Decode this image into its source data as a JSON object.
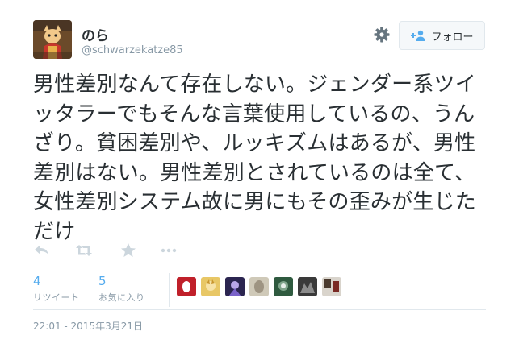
{
  "user": {
    "name": "のら",
    "handle": "@schwarzekatze85"
  },
  "follow_label": "フォロー",
  "tweet_text": "男性差別なんて存在しない。ジェンダー系ツイッタラーでもそんな言葉使用しているの、うんざり。貧困差別や、ルッキズムはあるが、男性差別はない。男性差別とされているのは全て、女性差別システム故に男にもその歪みが生じただけ",
  "actions": [
    "reply-icon",
    "retweet-icon",
    "favorite-icon",
    "more-icon"
  ],
  "stats": {
    "retweets": {
      "count": "4",
      "label": "リツイート"
    },
    "favorites": {
      "count": "5",
      "label": "お気に入り"
    }
  },
  "favoriters_count": 7,
  "timestamp": "22:01 - 2015年3月21日",
  "colors": {
    "link": "#55acee",
    "muted": "#8899a6",
    "text": "#292f33",
    "border": "#e1e8ed"
  }
}
